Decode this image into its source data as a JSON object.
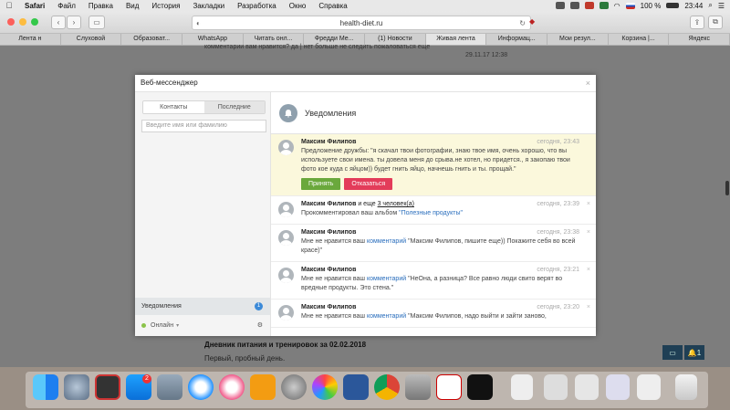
{
  "menubar": {
    "apple": "",
    "items": [
      "Safari",
      "Файл",
      "Правка",
      "Вид",
      "История",
      "Закладки",
      "Разработка",
      "Окно",
      "Справка"
    ],
    "battery": "100 %",
    "clock": "23:44"
  },
  "toolbar": {
    "back": "‹",
    "forward": "›",
    "url": "health-diet.ru",
    "reader": "◐",
    "reload": "↻"
  },
  "tabs": [
    "Лента н",
    "Слуховой",
    "Образоват...",
    "WhatsApp",
    "Читать онл...",
    "Фредди Ме...",
    "(1) Новости",
    "Живая лента",
    "Информац...",
    "Мои резул...",
    "Корзина |...",
    "Яндекс"
  ],
  "background_page": {
    "line1": "комментарии   вам нравится? да | нет   больше не следить   пожаловаться   еще",
    "date": "29.11.17 12:38",
    "diary_title": "Дневник питания и тренировок за 02.02.2018",
    "diary_sub": "Первый, пробный день.",
    "chat_icon": "▭",
    "bell_icon": "🔔1"
  },
  "dialog": {
    "title": "Веб-мессенджер",
    "close": "×",
    "tabs": {
      "contacts": "Контакты",
      "recent": "Последние"
    },
    "search_placeholder": "Введите имя или фамилию",
    "notif_label": "Уведомления",
    "notif_count": "1",
    "online_label": "Онлайн",
    "online_caret": "▾",
    "pane_title": "Уведомления",
    "items": [
      {
        "name": "Максим Филипов",
        "time": "сегодня, 23:43",
        "text": "Предложение дружбы: \"я скачал твои фотографии, знаю твое имя, очень хорошо, что вы используете свои имена. ты довела меня до срыва.не хотел, но придется., я закопаю твои фото кое куда с яйцом)) будет гнить яйцо, начнешь гнить и ты. прощай.\"",
        "accept": "Принять",
        "reject": "Отказаться"
      },
      {
        "name": "Максим Филипов",
        "name_suffix": " и еще ",
        "name_link": "3 человек(а)",
        "time": "сегодня, 23:39",
        "text_pre": "Прокомментировал ваш альбом ",
        "text_link": "\"Полезные продукты\""
      },
      {
        "name": "Максим Филипов",
        "time": "сегодня, 23:38",
        "text_pre": "Мне не нравится ваш ",
        "text_link": "комментарий",
        "text_post": " \"Максим Филипов, пишите еще)) Покажите себя во всей красе)\""
      },
      {
        "name": "Максим Филипов",
        "time": "сегодня, 23:21",
        "text_pre": "Мне не нравится ваш ",
        "text_link": "комментарий",
        "text_post": " \"НеОна, а разница? Все равно люди свито верят во вредные продукты. Это стена.\""
      },
      {
        "name": "Максим Филипов",
        "time": "сегодня, 23:20",
        "text_pre": "Мне не нравится ваш ",
        "text_link": "комментарий",
        "text_post": " \"Максим Филипов, надо выйти и зайти заново,"
      }
    ],
    "item_close": "×"
  },
  "dock": {
    "appstore_badge": "2",
    "apps": [
      "finder-icon",
      "launchpad-icon",
      "photo-booth-icon",
      "app-store-icon",
      "preview-icon",
      "safari-icon",
      "itunes-icon",
      "ibooks-icon",
      "system-preferences-icon",
      "photos-icon",
      "word-icon",
      "chrome-icon",
      "image-capture-icon",
      "polar-icon",
      "activity-monitor-icon"
    ]
  },
  "colors": {
    "accept": "#6aa83c",
    "reject": "#e33c5a",
    "link": "#2a6ebd",
    "highlight": "#fbf8dc",
    "badge": "#3c8ad8"
  }
}
